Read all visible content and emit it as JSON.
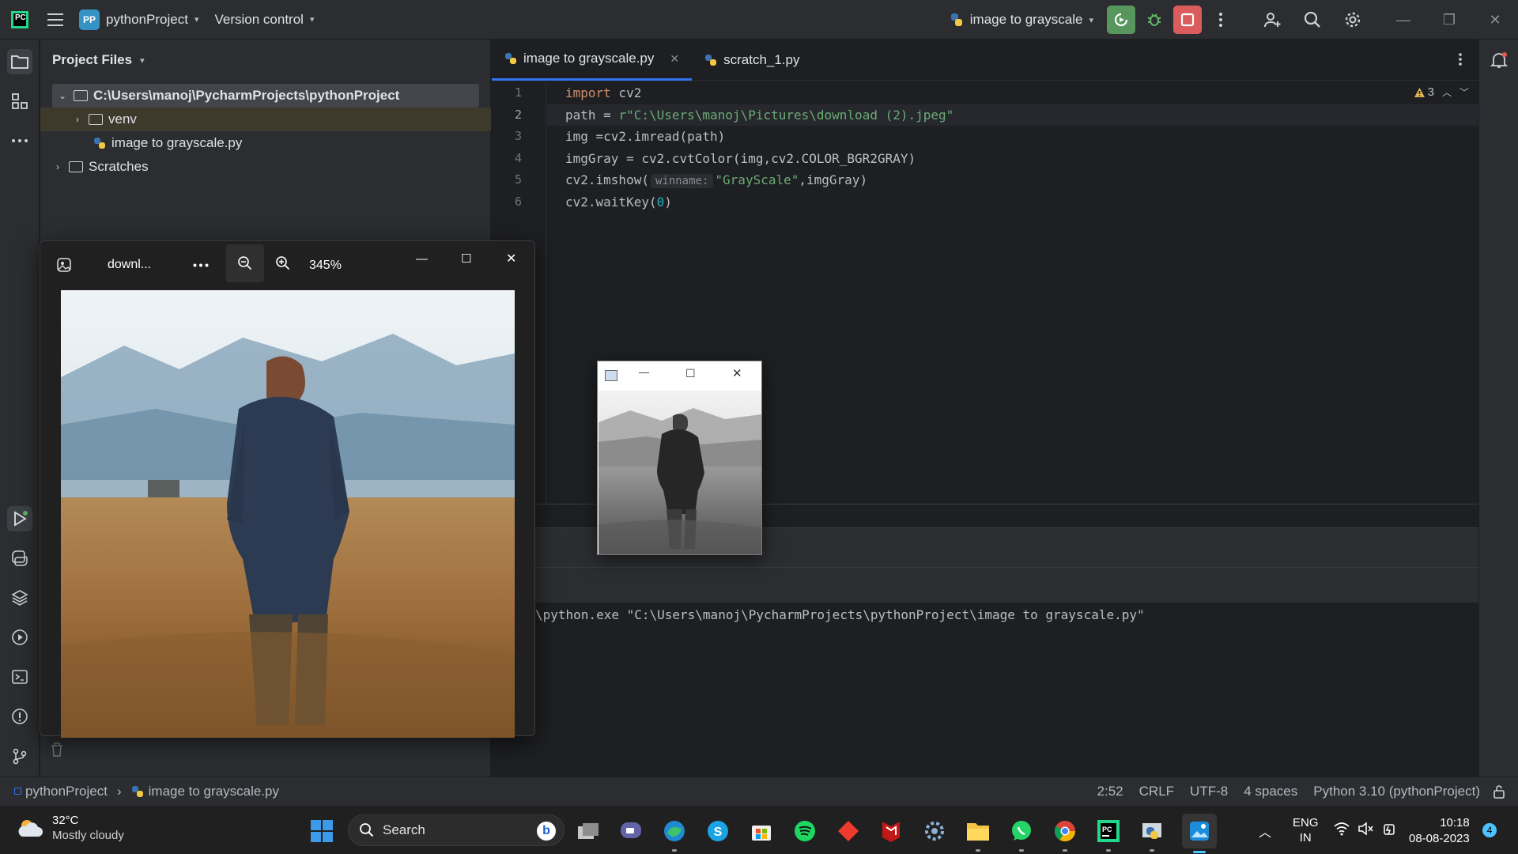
{
  "titlebar": {
    "logo": "PC",
    "project_badge": "PP",
    "project_name": "pythonProject",
    "vcs": "Version control",
    "run_config": "image to grayscale",
    "colors": {
      "run": "#57965c",
      "stop": "#db5c5c",
      "accent": "#3574f0"
    }
  },
  "project_panel": {
    "title": "Project Files",
    "root": "C:\\Users\\manoj\\PycharmProjects\\pythonProject",
    "venv": "venv",
    "file": "image to grayscale.py",
    "scratches": "Scratches"
  },
  "editor": {
    "tabs": [
      {
        "label": "image to grayscale.py",
        "active": true
      },
      {
        "label": "scratch_1.py",
        "active": false
      }
    ],
    "warnings": "3",
    "line_numbers": [
      "1",
      "2",
      "3",
      "4",
      "5",
      "6"
    ],
    "code": {
      "l1_kw": "import",
      "l1_rest": " cv2",
      "l2_a": "path = ",
      "l2_str": "r\"C:\\Users\\manoj\\Pictures\\download (2).jpeg\"",
      "l3": "img =cv2.imread(path)",
      "l4": "imgGray = cv2.cvtColor(img,cv2.COLOR_BGR2GRAY)",
      "l5_a": "cv2.imshow(",
      "l5_hint": "winname:",
      "l5_str": "\"GrayScale\"",
      "l5_b": ",imgGray)",
      "l6_a": "cv2.waitKey(",
      "l6_num": "0",
      "l6_b": ")"
    }
  },
  "console": {
    "command": "\\python.exe \"C:\\Users\\manoj\\PycharmProjects\\pythonProject\\image to grayscale.py\""
  },
  "statusbar": {
    "crumb_project": "pythonProject",
    "crumb_file": "image to grayscale.py",
    "position": "2:52",
    "line_sep": "CRLF",
    "encoding": "UTF-8",
    "indent": "4 spaces",
    "interpreter": "Python 3.10 (pythonProject)"
  },
  "photos": {
    "filename": "downl...",
    "zoom": "345%"
  },
  "taskbar": {
    "temperature": "32°C",
    "weather": "Mostly cloudy",
    "search": "Search",
    "lang1": "ENG",
    "lang2": "IN",
    "time": "10:18",
    "date": "08-08-2023",
    "notifications": "4"
  }
}
